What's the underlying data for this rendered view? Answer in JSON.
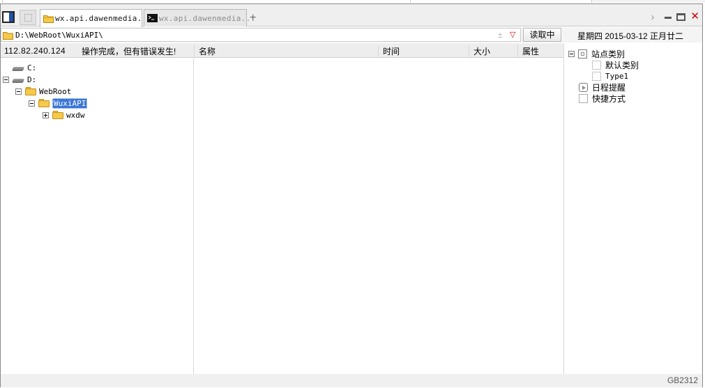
{
  "tabs": [
    {
      "label": "wx.api.dawenmedia...",
      "active": true,
      "icon": "folder-icon"
    },
    {
      "label": "wx.api.dawenmedia...",
      "active": false,
      "icon": "terminal-icon"
    }
  ],
  "new_tab_symbol": "+",
  "window_controls": {
    "chevron": "›",
    "close": "✕"
  },
  "address": {
    "path": "D:\\WebRoot\\WuxiAPI\\",
    "plusminus": "±",
    "dropdown": "▽",
    "read_button": "读取中"
  },
  "date_info": "星期四 2015-03-12 正月廿二",
  "header": {
    "ip": "112.82.240.124",
    "status": "操作完成，但有错误发生!",
    "columns": [
      "名称",
      "时间",
      "大小",
      "属性"
    ]
  },
  "tree": {
    "drive_c": "C:",
    "drive_d": "D:",
    "webroot": "WebRoot",
    "wuxiapi": "WuxiAPI",
    "wxdw": "wxdw"
  },
  "right_panel": {
    "site_category": "站点类别",
    "default_category": "默认类别",
    "type1": "Type1",
    "schedule": "日程提醒",
    "shortcuts": "快捷方式"
  },
  "encoding": "GB2312",
  "colors": {
    "accent": "#3b76d6",
    "close": "#d40000",
    "folder": "#f6c94a"
  }
}
